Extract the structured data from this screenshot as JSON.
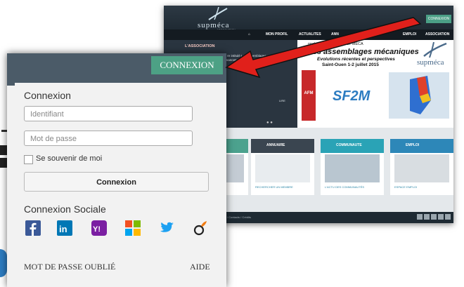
{
  "site": {
    "logo": "supméca",
    "logo_sub": "ASSOCIATION",
    "top_button": "CONNEXION",
    "nav": [
      "MON PROFIL",
      "ACTUALITES",
      "ANN",
      "EMPLOI",
      "ASSOCIATION"
    ],
    "hero_title": "L'ASSOCIATION",
    "hero_text": "015, l'association SUPMECA re intitulé Les assemblages ens évolutions et perspectives En effet, rformances, fiabilité, sécurité, demandées à la",
    "hero_more": "LIRE",
    "event_small": "nnel de l'Association SUPMECA",
    "event_title": "Les assemblages mécaniques",
    "event_sub": "Evolutions récentes et perspectives",
    "event_date": "Saint-Ouen 1-2 juillet 2015",
    "afm": "AFM",
    "afm_sub": "ASSOCIATION FRANÇAISE DE MÉCANIQUE",
    "sf2m": "SF2M",
    "cards": [
      {
        "title": "",
        "footer": "",
        "color": "#4ca28e"
      },
      {
        "title": "ANNUAIRE",
        "footer": "RECHERCHER UN MEMBRE",
        "color": "#3a4550"
      },
      {
        "title": "COMMUNAUTE",
        "footer": "L'ACTU DES COMMUNAUTÉS",
        "color": "#2aa3b6"
      },
      {
        "title": "EMPLOI",
        "footer": "ESPACE EMPLOI",
        "color": "#2d87b8"
      }
    ],
    "footer_text": "/ Contacts / Crédits"
  },
  "popup": {
    "connexion_tab": "CONNEXION",
    "title": "Connexion",
    "identifiant_placeholder": "Identifiant",
    "password_placeholder": "Mot de passe",
    "remember_label": "Se souvenir de moi",
    "submit_label": "Connexion",
    "social_title": "Connexion Sociale",
    "social_icons": [
      "facebook-icon",
      "linkedin-icon",
      "yahoo-icon",
      "microsoft-icon",
      "twitter-icon",
      "viadeo-icon"
    ],
    "forgot_label": "MOT DE PASSE OUBLIÉ",
    "help_label": "AIDE"
  },
  "colors": {
    "accent_green": "#4da185",
    "arrow_red": "#e0201b",
    "facebook": "#3b5998",
    "linkedin": "#0077b5",
    "yahoo": "#7b1fa2",
    "twitter": "#1da1f2"
  }
}
